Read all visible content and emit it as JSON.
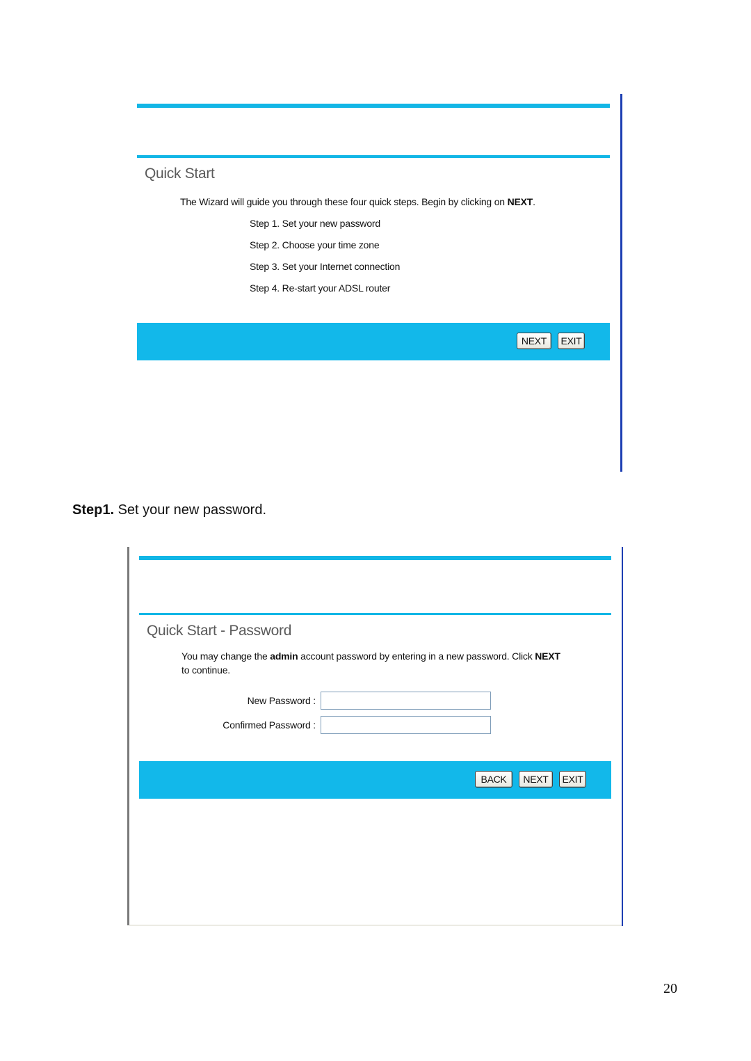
{
  "screenshot1": {
    "title": "Quick Start",
    "intro_prefix": "The Wizard will guide you through these four quick steps. Begin by clicking on ",
    "intro_bold": "NEXT",
    "intro_suffix": ".",
    "steps": [
      "Step 1. Set your new password",
      "Step 2. Choose your time zone",
      "Step 3. Set your Internet connection",
      "Step 4. Re-start your ADSL router"
    ],
    "buttons": {
      "next": "NEXT",
      "exit": "EXIT"
    }
  },
  "caption": {
    "bold": "Step1.",
    "text": " Set your new password."
  },
  "screenshot2": {
    "title": "Quick Start - Password",
    "desc_part1": "You may change the ",
    "desc_bold1": "admin",
    "desc_part2": " account password by entering in a new password. Click ",
    "desc_bold2": "NEXT",
    "desc_line2": "to continue.",
    "fields": {
      "new_password_label": "New Password :",
      "new_password_value": "",
      "confirmed_password_label": "Confirmed Password :",
      "confirmed_password_value": ""
    },
    "buttons": {
      "back": "BACK",
      "next": "NEXT",
      "exit": "EXIT"
    }
  },
  "page_number": "20",
  "colors": {
    "accent_cyan": "#12b8ea",
    "frame_blue": "#1d3fb3"
  }
}
